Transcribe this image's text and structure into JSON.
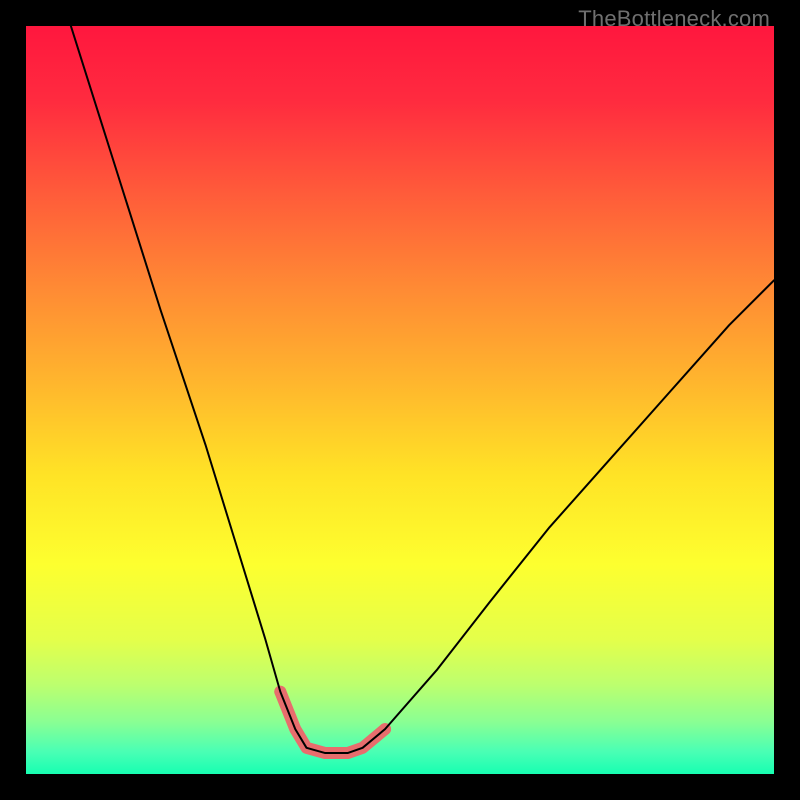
{
  "watermark": {
    "text": "TheBottleneck.com"
  },
  "gradient": {
    "stops": [
      {
        "offset": 0.0,
        "color": "#ff173e"
      },
      {
        "offset": 0.1,
        "color": "#ff2b3f"
      },
      {
        "offset": 0.22,
        "color": "#ff5a3a"
      },
      {
        "offset": 0.35,
        "color": "#ff8a34"
      },
      {
        "offset": 0.48,
        "color": "#ffb72d"
      },
      {
        "offset": 0.6,
        "color": "#ffe326"
      },
      {
        "offset": 0.72,
        "color": "#fdff2f"
      },
      {
        "offset": 0.82,
        "color": "#e4ff4a"
      },
      {
        "offset": 0.88,
        "color": "#bdff6e"
      },
      {
        "offset": 0.93,
        "color": "#8aff93"
      },
      {
        "offset": 0.97,
        "color": "#4affb4"
      },
      {
        "offset": 1.0,
        "color": "#17ffb2"
      }
    ]
  },
  "chart_data": {
    "type": "line",
    "title": "",
    "xlabel": "",
    "ylabel": "",
    "xlim": [
      0,
      100
    ],
    "ylim": [
      0,
      100
    ],
    "grid": false,
    "legend": null,
    "series": [
      {
        "name": "bottleneck-curve",
        "x": [
          6,
          12,
          18,
          24,
          28,
          32,
          34,
          36,
          37.5,
          40,
          43,
          45,
          48,
          55,
          62,
          70,
          78,
          86,
          94,
          100
        ],
        "y": [
          100,
          81,
          62,
          44,
          31,
          18,
          11,
          6,
          3.5,
          2.8,
          2.8,
          3.5,
          6,
          14,
          23,
          33,
          42,
          51,
          60,
          66
        ]
      },
      {
        "name": "flat-bottom-highlight",
        "x": [
          34,
          36,
          37.5,
          40,
          43,
          45,
          48
        ],
        "y": [
          11,
          6,
          3.5,
          2.8,
          2.8,
          3.5,
          6
        ]
      }
    ],
    "styles": {
      "bottleneck-curve": {
        "stroke": "#000000",
        "width": 2
      },
      "flat-bottom-highlight": {
        "stroke": "#e86d6d",
        "width": 12,
        "linecap": "round",
        "dot_radius": 6
      }
    }
  }
}
